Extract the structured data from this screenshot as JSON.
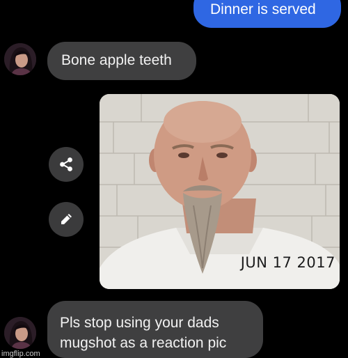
{
  "messages": {
    "sent_1": "Dinner is served",
    "received_1": "Bone apple teeth",
    "received_2_line_1": "Pls stop using your dads",
    "received_2_line_2": "mugshot as a reaction pic"
  },
  "photo": {
    "date_stamp": "JUN 17 2017"
  },
  "actions": {
    "share_icon": "share-icon",
    "edit_icon": "pencil-icon"
  },
  "watermark": "imgflip.com",
  "colors": {
    "background": "#000000",
    "sent_bubble": "#2f67e3",
    "received_bubble": "#3f3f40",
    "action_button": "#3b3b3c"
  }
}
